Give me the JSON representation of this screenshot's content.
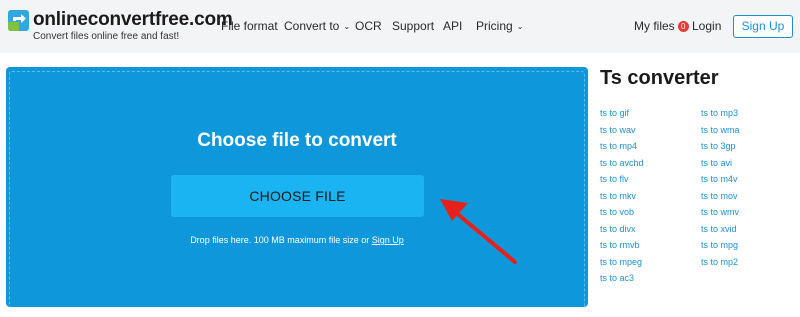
{
  "header": {
    "logo_text": "onlineconvertfree.com",
    "tagline": "Convert files online free and fast!",
    "nav": {
      "file_format": "File format",
      "convert_to": "Convert to",
      "ocr": "OCR",
      "support": "Support",
      "api": "API",
      "pricing": "Pricing"
    },
    "my_files": "My files",
    "my_files_count": "0",
    "login": "Login",
    "signup": "Sign Up"
  },
  "upload": {
    "title": "Choose file to convert",
    "button": "CHOOSE FILE",
    "drop_text": "Drop files here. 100 MB maximum file size or",
    "signup_link": "Sign Up"
  },
  "sidebar": {
    "title": "Ts converter",
    "left_links": [
      "ts to gif",
      "ts to wav",
      "ts to mp4",
      "ts to avchd",
      "ts to flv",
      "ts to mkv",
      "ts to vob",
      "ts to divx",
      "ts to rmvb",
      "ts to mpeg",
      "ts to ac3"
    ],
    "right_links": [
      "ts to mp3",
      "ts to wma",
      "ts to 3gp",
      "ts to avi",
      "ts to m4v",
      "ts to mov",
      "ts to wmv",
      "ts to xvid",
      "ts to mpg",
      "ts to mp2"
    ]
  },
  "colors": {
    "brand_blue": "#0e97da",
    "button_blue": "#1ab4f3",
    "link_blue": "#1d8fd1",
    "badge_red": "#e83a3a",
    "arrow_red": "#e8201a"
  },
  "icons": {
    "logo": "convert-arrows-icon",
    "dropdown": "chevron-down-icon",
    "annotation": "red-arrow-icon"
  }
}
